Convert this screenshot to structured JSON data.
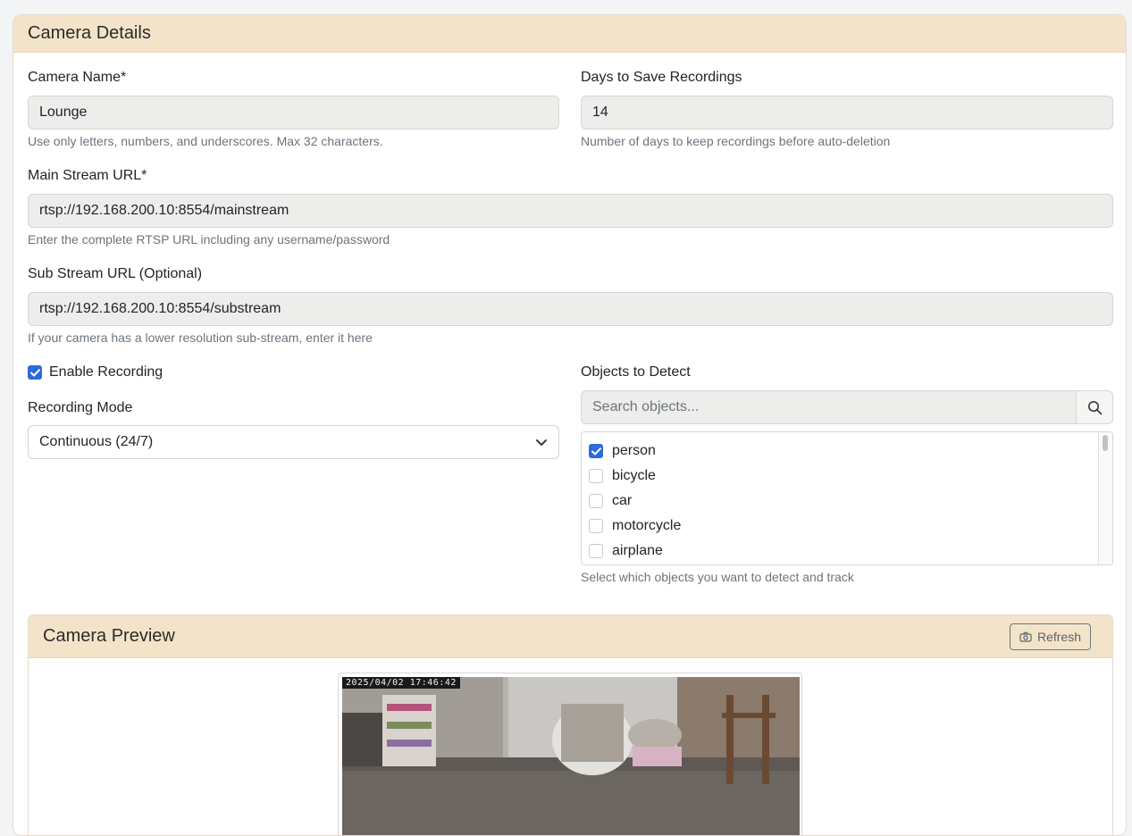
{
  "card": {
    "title": "Camera Details"
  },
  "fields": {
    "camera_name": {
      "label": "Camera Name*",
      "value": "Lounge",
      "help": "Use only letters, numbers, and underscores. Max 32 characters."
    },
    "days_to_save": {
      "label": "Days to Save Recordings",
      "value": "14",
      "help": "Number of days to keep recordings before auto-deletion"
    },
    "main_stream": {
      "label": "Main Stream URL*",
      "value": "rtsp://192.168.200.10:8554/mainstream",
      "help": "Enter the complete RTSP URL including any username/password"
    },
    "sub_stream": {
      "label": "Sub Stream URL (Optional)",
      "value": "rtsp://192.168.200.10:8554/substream",
      "help": "If your camera has a lower resolution sub-stream, enter it here"
    }
  },
  "recording": {
    "enable_label": "Enable Recording",
    "enabled": true,
    "mode_label": "Recording Mode",
    "mode_value": "Continuous (24/7)"
  },
  "objects": {
    "label": "Objects to Detect",
    "search_placeholder": "Search objects...",
    "items": [
      {
        "name": "person",
        "checked": true
      },
      {
        "name": "bicycle",
        "checked": false
      },
      {
        "name": "car",
        "checked": false
      },
      {
        "name": "motorcycle",
        "checked": false
      },
      {
        "name": "airplane",
        "checked": false
      }
    ],
    "help": "Select which objects you want to detect and track"
  },
  "preview": {
    "title": "Camera Preview",
    "refresh_label": "Refresh",
    "timestamp": "2025/04/02  17:46:42"
  },
  "colors": {
    "header_bg": "#f3e4c9",
    "accent": "#2f6bd8"
  },
  "icons": {
    "search": "search-icon",
    "camera": "camera-icon",
    "chevron": "chevron-down-icon",
    "check": "check-icon"
  }
}
